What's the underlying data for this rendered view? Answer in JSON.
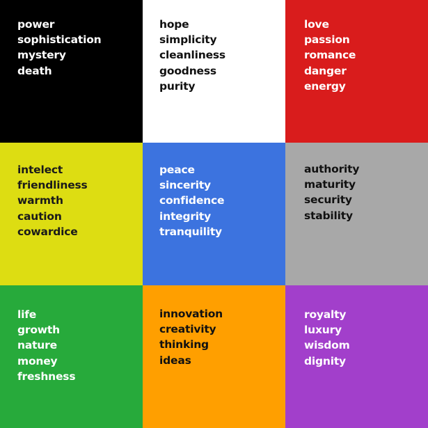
{
  "cells": [
    {
      "background": "#000000",
      "text_color": "#ffffff",
      "words": [
        "power",
        "sophistication",
        "mystery",
        "death"
      ]
    },
    {
      "background": "#ffffff",
      "text_color": "#111111",
      "words": [
        "hope",
        "simplicity",
        "cleanliness",
        "goodness",
        "purity"
      ]
    },
    {
      "background": "#d91c1c",
      "text_color": "#ffffff",
      "words": [
        "love",
        "passion",
        "romance",
        "danger",
        "energy"
      ]
    },
    {
      "background": "#dddd12",
      "text_color": "#1a1a1a",
      "words": [
        "intelect",
        "friendliness",
        "warmth",
        "caution",
        "cowardice"
      ]
    },
    {
      "background": "#3c73df",
      "text_color": "#ffffff",
      "words": [
        "peace",
        "sincerity",
        "confidence",
        "integrity",
        "tranquility"
      ]
    },
    {
      "background": "#a8a8a8",
      "text_color": "#111111",
      "words": [
        "authority",
        "maturity",
        "security",
        "stability"
      ]
    },
    {
      "background": "#27aa3b",
      "text_color": "#ffffff",
      "words": [
        "life",
        "growth",
        "nature",
        "money",
        "freshness"
      ]
    },
    {
      "background": "#ff9f00",
      "text_color": "#111111",
      "words": [
        "innovation",
        "creativity",
        "thinking",
        "ideas"
      ]
    },
    {
      "background": "#a23fcb",
      "text_color": "#ffffff",
      "words": [
        "royalty",
        "luxury",
        "wisdom",
        "dignity"
      ]
    }
  ]
}
